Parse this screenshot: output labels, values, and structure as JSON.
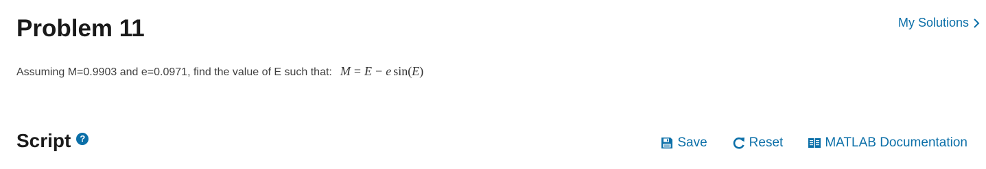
{
  "header": {
    "title": "Problem 11",
    "my_solutions_label": "My Solutions"
  },
  "problem": {
    "description": "Assuming M=0.9903 and e=0.0971, find the value of E such that:",
    "equation": {
      "lhs": "M",
      "equals": "=",
      "term1": "E",
      "minus": "−",
      "coef": "e",
      "func": "sin",
      "open": "(",
      "arg": "E",
      "close": ")"
    }
  },
  "script": {
    "title": "Script",
    "help_glyph": "?"
  },
  "toolbar": {
    "save_label": "Save",
    "reset_label": "Reset",
    "docs_label": "MATLAB Documentation"
  },
  "colors": {
    "accent": "#0b6fa8",
    "text": "#1a1a1a",
    "body_text": "#404040"
  },
  "icons": [
    "chevron-right-icon",
    "help-icon",
    "floppy-disk-icon",
    "reset-icon",
    "book-icon"
  ]
}
